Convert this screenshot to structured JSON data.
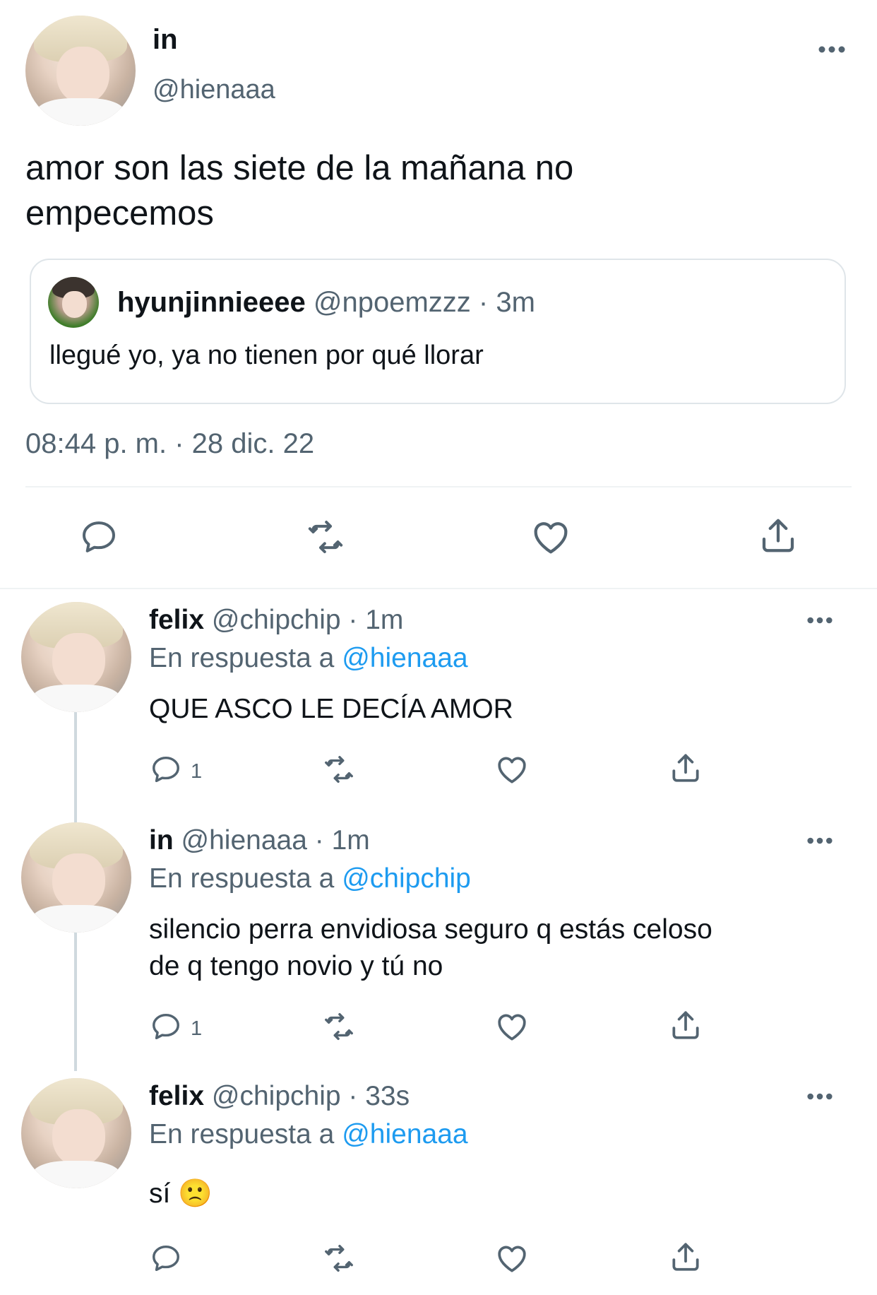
{
  "main_tweet": {
    "author_name": "in",
    "author_handle": "@hienaaa",
    "text_line1": "amor son las siete de la mañana no",
    "text_line2": "empecemos",
    "quote": {
      "author_name": "hyunjinnieeee",
      "author_handle": "@npoemzzz",
      "separator": "·",
      "time": "3m",
      "text": "llegué yo, ya no tienen por qué llorar"
    },
    "timestamp": "08:44 p. m. · 28 dic. 22"
  },
  "replies": [
    {
      "author_name": "felix",
      "author_handle": "@chipchip",
      "meta": " · 1m",
      "reply_prefix": "En respuesta a",
      "reply_to": "@hienaaa",
      "text_line1": "QUE ASCO LE DECÍA AMOR",
      "text_line2": "",
      "reply_count": "1"
    },
    {
      "author_name": "in",
      "author_handle": "@hienaaa",
      "meta": " · 1m",
      "reply_prefix": "En respuesta a",
      "reply_to": "@chipchip",
      "text_line1": "silencio perra envidiosa seguro q estás celoso",
      "text_line2": "de q tengo novio y tú no",
      "reply_count": "1"
    },
    {
      "author_name": "felix",
      "author_handle": "@chipchip",
      "meta": " · 33s",
      "reply_prefix": "En respuesta a",
      "reply_to": "@hienaaa",
      "text_line1": "sí",
      "text_line2": "",
      "reply_count": "",
      "emoji": "🙁"
    }
  ],
  "icons": {
    "more": "more-icon",
    "reply": "reply-icon",
    "retweet": "retweet-icon",
    "like": "heart-icon",
    "share": "share-icon"
  },
  "colors": {
    "text": "#0f1419",
    "muted": "#536471",
    "link": "#1d9bf0",
    "border": "#cfd9de"
  }
}
